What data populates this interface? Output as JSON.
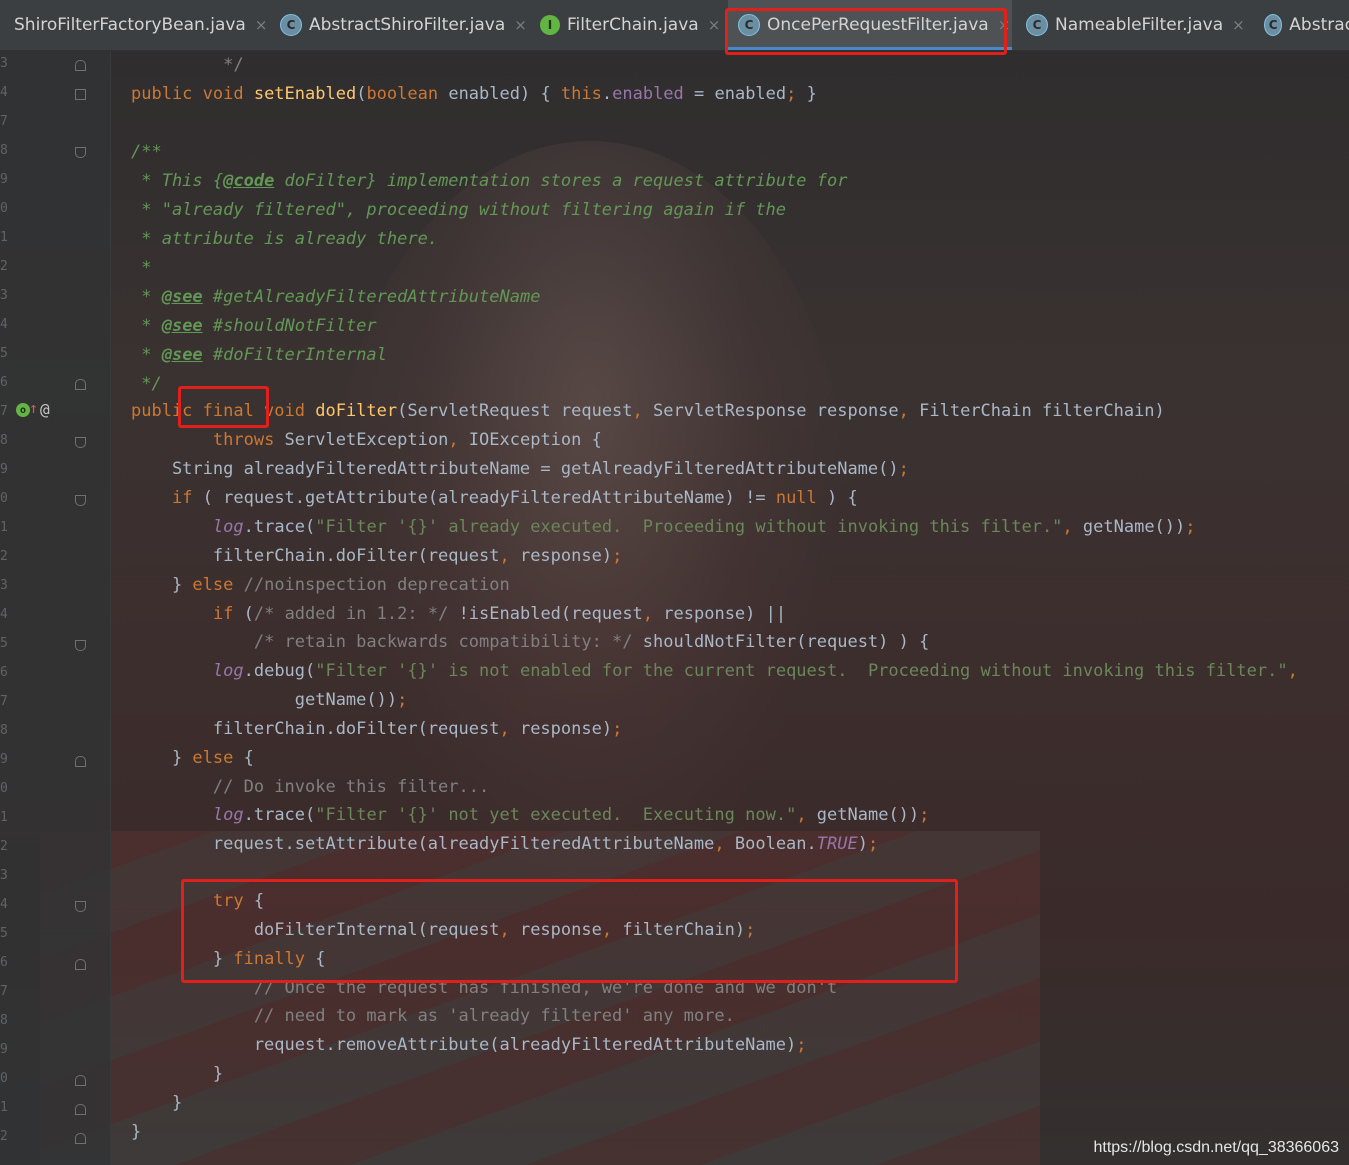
{
  "tabs": [
    {
      "label": "ShiroFilterFactoryBean.java",
      "icon": "class-icon",
      "close": "×",
      "active": false
    },
    {
      "label": "AbstractShiroFilter.java",
      "icon": "abstract-class-icon",
      "close": "×",
      "active": false
    },
    {
      "label": "FilterChain.java",
      "icon": "interface-icon",
      "close": "×",
      "active": false
    },
    {
      "label": "OncePerRequestFilter.java",
      "icon": "abstract-class-icon",
      "close": "×",
      "active": true
    },
    {
      "label": "NameableFilter.java",
      "icon": "abstract-class-icon",
      "close": "×",
      "active": false
    },
    {
      "label": "Abstrac",
      "icon": "abstract-class-icon",
      "close": "",
      "active": false
    }
  ],
  "gutter": {
    "line_numbers": [
      "3",
      "4",
      "7",
      "8",
      "9",
      "0",
      "1",
      "2",
      "3",
      "4",
      "5",
      "6",
      "7",
      "8",
      "9",
      "0",
      "1",
      "2",
      "3",
      "4",
      "5",
      "6",
      "7",
      "8",
      "9",
      "0",
      "1",
      "2",
      "3",
      "4",
      "5",
      "6",
      "7",
      "8",
      "9",
      "0",
      "1",
      "2"
    ],
    "override_icon": "override-method-icon",
    "annotation_symbol": "@"
  },
  "code_lines": [
    "         */",
    "public void setEnabled(boolean enabled) { this.enabled = enabled; }",
    "",
    "/**",
    " * This {@code doFilter} implementation stores a request attribute for",
    " * \"already filtered\", proceeding without filtering again if the",
    " * attribute is already there.",
    " *",
    " * @see #getAlreadyFilteredAttributeName",
    " * @see #shouldNotFilter",
    " * @see #doFilterInternal",
    " */",
    "public final void doFilter(ServletRequest request, ServletResponse response, FilterChain filterChain)",
    "        throws ServletException, IOException {",
    "    String alreadyFilteredAttributeName = getAlreadyFilteredAttributeName();",
    "    if ( request.getAttribute(alreadyFilteredAttributeName) != null ) {",
    "        log.trace(\"Filter '{}' already executed.  Proceeding without invoking this filter.\", getName());",
    "        filterChain.doFilter(request, response);",
    "    } else //noinspection deprecation",
    "        if (/* added in 1.2: */ !isEnabled(request, response) ||",
    "            /* retain backwards compatibility: */ shouldNotFilter(request) ) {",
    "        log.debug(\"Filter '{}' is not enabled for the current request.  Proceeding without invoking this filter.\",",
    "                getName());",
    "        filterChain.doFilter(request, response);",
    "    } else {",
    "        // Do invoke this filter...",
    "        log.trace(\"Filter '{}' not yet executed.  Executing now.\", getName());",
    "        request.setAttribute(alreadyFilteredAttributeName, Boolean.TRUE);",
    "",
    "        try {",
    "            doFilterInternal(request, response, filterChain);",
    "        } finally {",
    "            // Once the request has finished, we're done and we don't",
    "            // need to mark as 'already filtered' any more.",
    "            request.removeAttribute(alreadyFilteredAttributeName);",
    "        }",
    "    }",
    "}"
  ],
  "watermark": "https://blog.csdn.net/qq_38366063",
  "colors": {
    "highlight": "#e0201b",
    "keyword": "#cc7832",
    "method": "#ffc66d",
    "string": "#6a8759",
    "comment": "#808080",
    "doc_comment": "#629755",
    "field": "#9876aa",
    "plain": "#a9b7c6",
    "active_tab_underline": "#4a88c7"
  }
}
